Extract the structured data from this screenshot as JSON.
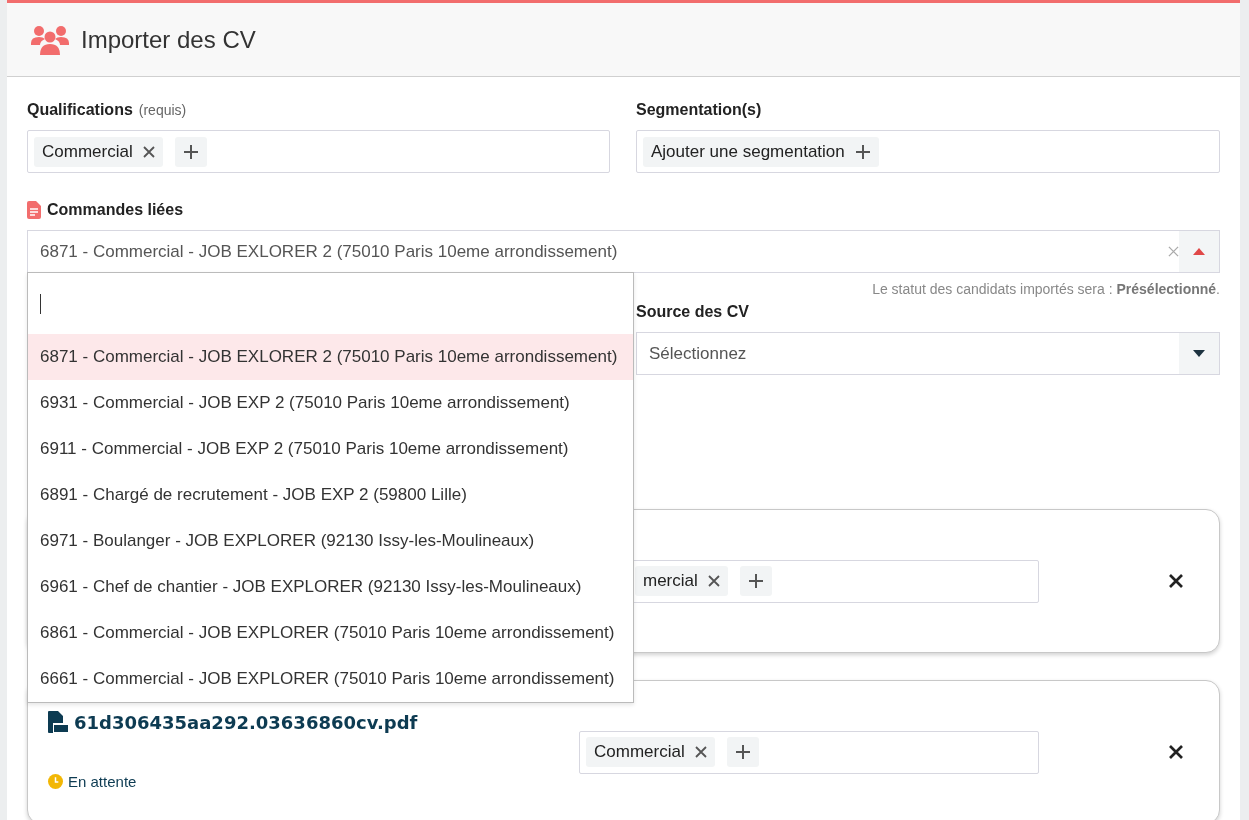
{
  "header": {
    "title": "Importer des CV"
  },
  "qualifications": {
    "label": "Qualifications",
    "hint": "(requis)",
    "tags": [
      {
        "label": "Commercial"
      }
    ]
  },
  "segmentations": {
    "label": "Segmentation(s)",
    "add_label": "Ajouter une segmentation"
  },
  "linked_orders": {
    "label": "Commandes liées",
    "value": "6871 - Commercial - JOB EXLORER 2 (75010 Paris 10eme arrondissement)",
    "expanded": true,
    "options": [
      {
        "label": "6871 - Commercial - JOB EXLORER 2 (75010 Paris 10eme arrondissement)",
        "selected": true
      },
      {
        "label": "6931 - Commercial - JOB EXP 2 (75010 Paris 10eme arrondissement)",
        "selected": false
      },
      {
        "label": "6911 - Commercial - JOB EXP 2 (75010 Paris 10eme arrondissement)",
        "selected": false
      },
      {
        "label": "6891 - Chargé de recrutement - JOB EXP 2 (59800 Lille)",
        "selected": false
      },
      {
        "label": "6971 - Boulanger - JOB EXPLORER (92130 Issy-les-Moulineaux)",
        "selected": false
      },
      {
        "label": "6961 - Chef de chantier - JOB EXPLORER (92130 Issy-les-Moulineaux)",
        "selected": false
      },
      {
        "label": "6861 - Commercial - JOB EXPLORER (75010 Paris 10eme arrondissement)",
        "selected": false
      },
      {
        "label": "6661 - Commercial - JOB EXPLORER (75010 Paris 10eme arrondissement)",
        "selected": false
      }
    ]
  },
  "status_note": {
    "text": "Le statut des candidats importés sera : **Présélectionné**."
  },
  "source": {
    "label": "Source des CV",
    "placeholder": "Sélectionnez"
  },
  "files": [
    {
      "tags": [
        {
          "label": "mercial"
        }
      ]
    },
    {
      "name": "61d306435aa292.03636860cv.pdf",
      "status": "En attente",
      "tags": [
        {
          "label": "Commercial"
        }
      ]
    }
  ]
}
